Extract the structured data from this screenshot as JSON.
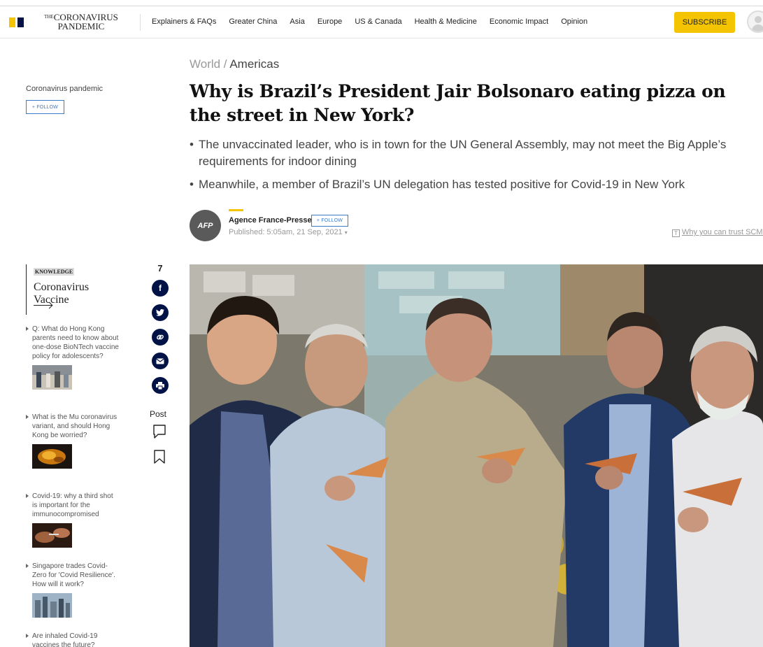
{
  "header": {
    "logo_the": "THE",
    "logo_line1": "CORONAVIRUS",
    "logo_line2": "PANDEMIC",
    "nav": [
      "Explainers & FAQs",
      "Greater China",
      "Asia",
      "Europe",
      "US & Canada",
      "Health & Medicine",
      "Economic Impact",
      "Opinion"
    ],
    "subscribe_label": "SUBSCRIBE"
  },
  "left_rail": {
    "topic": "Coronavirus pandemic",
    "follow_label": "+ FOLLOW",
    "knowledge_tag": "KNOWLEDGE",
    "knowledge_title": "Coronavirus Vaccine",
    "related": [
      {
        "title": "Q: What do Hong Kong parents need to know about one-dose BioNTech vaccine policy for adolescents?"
      },
      {
        "title": "What is the Mu coronavirus variant, and should Hong Kong be worried?"
      },
      {
        "title": "Covid-19: why a third shot is important for the immunocompromised"
      },
      {
        "title": "Singapore trades Covid-Zero for 'Covid Resilience'. How will it work?"
      },
      {
        "title": "Are inhaled Covid-19 vaccines the future?"
      }
    ]
  },
  "share": {
    "count": "7",
    "post_label": "Post"
  },
  "article": {
    "breadcrumb_parent": "World /",
    "breadcrumb_current": "Americas",
    "headline": "Why is Brazil’s President Jair Bolsonaro eating pizza on the street in New York?",
    "summary_bullet": "•",
    "summary": [
      "The unvaccinated leader, who is in town for the UN General Assembly, may not meet the Big Apple’s requirements for indoor dining",
      "Meanwhile, a member of Brazil’s UN delegation has tested positive for Covid-19 in New York"
    ],
    "author_logo": "AFP",
    "author": "Agence France-Presse",
    "follow_label": "+ FOLLOW",
    "published": "Published: 5:05am, 21 Sep, 2021",
    "trust_link": "Why you can trust SCMP"
  },
  "colors": {
    "brand_yellow": "#f5c400",
    "brand_navy": "#001246",
    "follow_blue": "#3b7ac7"
  },
  "icons": [
    "facebook-icon",
    "twitter-icon",
    "link-icon",
    "email-icon",
    "print-icon",
    "comment-icon",
    "bookmark-icon"
  ]
}
